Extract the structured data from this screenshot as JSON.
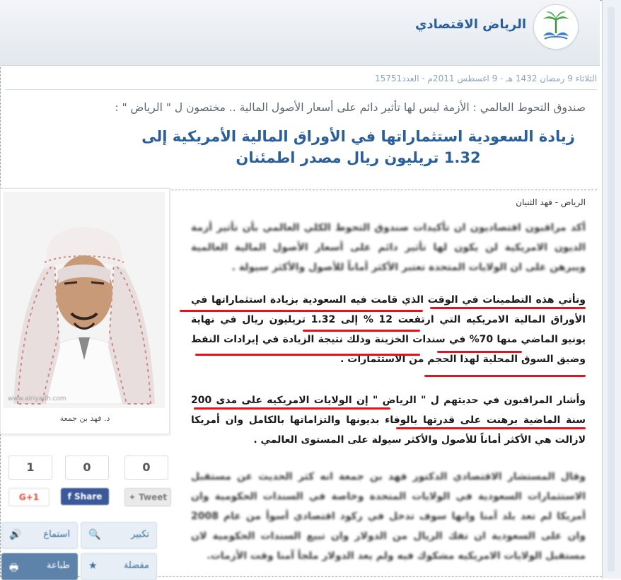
{
  "brand": {
    "title": "الرياض الاقتصادي",
    "logo_icon": "palm-logo-icon"
  },
  "article": {
    "date_line": "الثلاثاء 9 رمضان 1432 هـ - 9 اغسطس 2011م - العدد15751",
    "supertitle": "صندوق التحوط العالمي : الأزمة ليس لها تأثير دائم على أسعار الأصول المالية .. مختصون ل \" الرياض \" :",
    "headline": "زيادة السعودية استثماراتها في الأوراق المالية الأمريكية إلى 1.32 تريليون ريال مصدر اطمئنان",
    "byline": "الرياض - فهد الثنيان",
    "paragraphs": [
      "أكد مراقبون اقتصاديون ان تأكيدات صندوق التحوط الكلي العالمي بأن تأثير أزمة الديون الامريكية لن يكون لها تأثير دائم على أسعار الأصول المالية العالمية ويبرهن على ان الولايات المتحدة تعتبر الأكثر أماناً للأصول والأكثر سيولة .",
      "وتأتي هذه التطمينات في الوقت الذي قامت فيه السعودية بزيادة استثماراتها في الأوراق المالية الامريكيه التي ارتفعت 12 % إلى 1.32 تريليون ريال في نهاية يونيو الماضي منها 70% في سندات الخزينة وذلك نتيجة الزيادة في إيرادات النفط وضيق السوق المحلية لهذا الحجم من الاستثمارات .",
      "وأشار المراقبون في حديثهم ل \" الرياض \" إن الولايات الامريكيه على مدى 200 سنة الماضية برهنت على قدرتها بالوفاء بديونها والتزاماتها بالكامل وان أمريكا لازالت هي الأكثر أماناً للأصول والأكثر سيولة على المستوى العالمي .",
      "وقال المستشار الاقتصادي الدكتور فهد بن جمعة انه كثر الحديث عن مستقبل الاستثمارات السعودية في الولايات المتحدة وخاصة في السندات الحكومية وان أمريكا لم تعد بلد آمنا وانها سوف تدخل في ركود اقتصادي أسوأ من عام 2008 وان على السعودية ان تفك الريال من الدولار وان تبيع السندات الحكومية لان مستقبل الولايات الامريكيه مشكوك فيه ولم يعد الدولار ملجأ آمنا وقت الأزمات."
    ]
  },
  "photo": {
    "caption": "د. فهد بن جمعة",
    "url_text": "www.alriyadh.com"
  },
  "share": {
    "counts": [
      "0",
      "0",
      "1"
    ],
    "tweet_label": "Tweet",
    "share_label": "Share",
    "gplus_label": "G+1"
  },
  "tools": {
    "zoom_label": "تكبير",
    "listen_label": "استماع",
    "favorite_label": "مفضلة",
    "print_label": "طباعة"
  },
  "colors": {
    "accent": "#2a5f9b",
    "underline": "#e5131b",
    "share_fb": "#3b5998"
  }
}
